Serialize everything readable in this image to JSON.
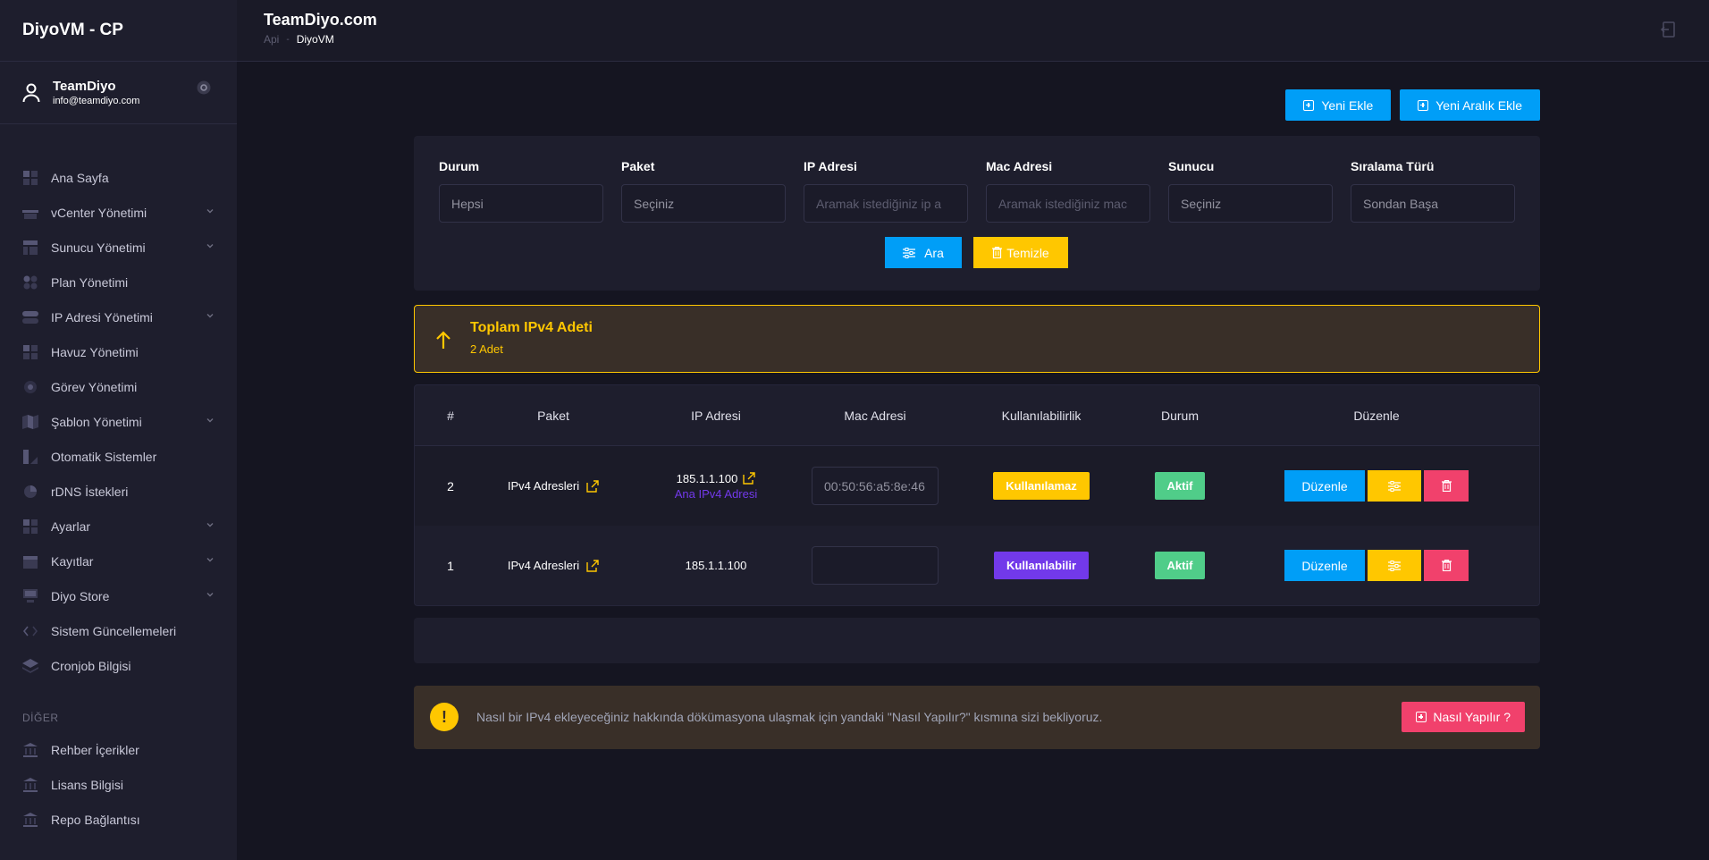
{
  "sidebar": {
    "brand": "DiyoVM - CP",
    "user": {
      "name": "TeamDiyo",
      "email": "info@teamdiyo.com"
    },
    "items": [
      {
        "label": "Ana Sayfa",
        "icon": "grid-icon",
        "has_children": false
      },
      {
        "label": "vCenter Yönetimi",
        "icon": "basket-icon",
        "has_children": true
      },
      {
        "label": "Sunucu Yönetimi",
        "icon": "layout-icon",
        "has_children": true
      },
      {
        "label": "Plan Yönetimi",
        "icon": "apps-icon",
        "has_children": false
      },
      {
        "label": "IP Adresi Yönetimi",
        "icon": "toggle-icon",
        "has_children": true
      },
      {
        "label": "Havuz Yönetimi",
        "icon": "grid-icon",
        "has_children": false
      },
      {
        "label": "Görev Yönetimi",
        "icon": "target-icon",
        "has_children": false
      },
      {
        "label": "Şablon Yönetimi",
        "icon": "map-icon",
        "has_children": true
      },
      {
        "label": "Otomatik Sistemler",
        "icon": "brush-icon",
        "has_children": false
      },
      {
        "label": "rDNS İstekleri",
        "icon": "pie-icon",
        "has_children": false
      },
      {
        "label": "Ayarlar",
        "icon": "grid-icon",
        "has_children": true
      },
      {
        "label": "Kayıtlar",
        "icon": "calendar-icon",
        "has_children": true
      },
      {
        "label": "Diyo Store",
        "icon": "store-icon",
        "has_children": true
      },
      {
        "label": "Sistem Güncellemeleri",
        "icon": "code-icon",
        "has_children": false
      },
      {
        "label": "Cronjob Bilgisi",
        "icon": "layers-icon",
        "has_children": false
      }
    ],
    "other_label": "DİĞER",
    "other_items": [
      {
        "label": "Rehber İçerikler",
        "icon": "bank-icon"
      },
      {
        "label": "Lisans Bilgisi",
        "icon": "bank-icon"
      },
      {
        "label": "Repo Bağlantısı",
        "icon": "bank-icon"
      }
    ]
  },
  "header": {
    "title": "TeamDiyo.com",
    "breadcrumb": [
      "Api",
      "DiyoVM"
    ]
  },
  "toolbar": {
    "new_label": "Yeni Ekle",
    "new_range_label": "Yeni Aralık Ekle"
  },
  "filters": {
    "fields": [
      {
        "label": "Durum",
        "value": "Hepsi",
        "placeholder": false
      },
      {
        "label": "Paket",
        "value": "Seçiniz",
        "placeholder": false
      },
      {
        "label": "IP Adresi",
        "value": "Aramak istediğiniz ip a",
        "placeholder": true
      },
      {
        "label": "Mac Adresi",
        "value": "Aramak istediğiniz mac",
        "placeholder": true
      },
      {
        "label": "Sunucu",
        "value": "Seçiniz",
        "placeholder": false
      },
      {
        "label": "Sıralama Türü",
        "value": "Sondan Başa",
        "placeholder": false
      }
    ],
    "search_label": "Ara",
    "clear_label": "Temizle"
  },
  "summary": {
    "title": "Toplam IPv4 Adeti",
    "subtitle": "2 Adet"
  },
  "table": {
    "headers": [
      "#",
      "Paket",
      "IP Adresi",
      "Mac Adresi",
      "Kullanılabilirlik",
      "Durum",
      "Düzenle"
    ],
    "rows": [
      {
        "id": "2",
        "package": "IPv4 Adresleri",
        "ip": "185.1.1.100",
        "ip_note": "Ana IPv4 Adresi",
        "mac": "00:50:56:a5:8e:46",
        "availability": "Kullanılamaz",
        "availability_color": "#ffc700",
        "status": "Aktif",
        "edit_label": "Düzenle"
      },
      {
        "id": "1",
        "package": "IPv4 Adresleri",
        "ip": "185.1.1.100",
        "ip_note": "",
        "mac": "",
        "availability": "Kullanılabilir",
        "availability_color": "#7239ea",
        "status": "Aktif",
        "edit_label": "Düzenle"
      }
    ]
  },
  "info": {
    "text": "Nasıl bir IPv4 ekleyeceğiniz hakkında dökümasyona ulaşmak için yandaki \"Nasıl Yapılır?\" kısmına sizi bekliyoruz.",
    "button_label": "Nasıl Yapılır ?"
  },
  "colors": {
    "primary": "#009ef7",
    "warning": "#ffc700",
    "success": "#50cd89",
    "danger": "#f1416c",
    "purple": "#7239ea"
  }
}
